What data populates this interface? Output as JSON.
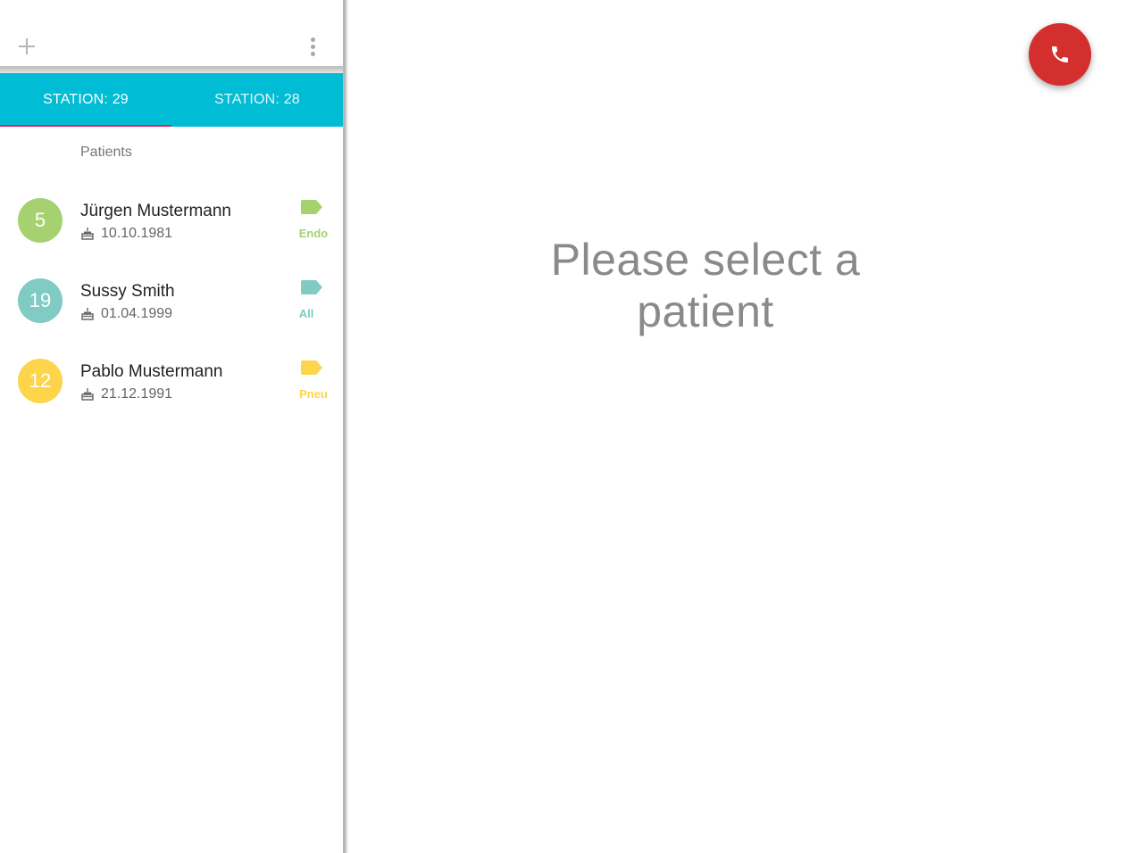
{
  "toolbar": {
    "add_icon": "plus-icon",
    "menu_icon": "more-vert-icon"
  },
  "tabs": [
    {
      "label": "STATION: 29",
      "selected": true
    },
    {
      "label": "STATION: 28",
      "selected": false
    }
  ],
  "colors": {
    "tab_bar": "#00bcd4",
    "tab_indicator": "#e91e63",
    "call_button": "#d32f2f"
  },
  "patients_header": "Patients",
  "patients": [
    {
      "number": "5",
      "name": "Jürgen Mustermann",
      "dob": "10.10.1981",
      "tag": "Endo",
      "color": "#a5d16f"
    },
    {
      "number": "19",
      "name": "Sussy Smith",
      "dob": "01.04.1999",
      "tag": "All",
      "color": "#80cbc4"
    },
    {
      "number": "12",
      "name": "Pablo Mustermann",
      "dob": "21.12.1991",
      "tag": "Pneu",
      "color": "#fdd54a"
    }
  ],
  "main": {
    "placeholder_line1": "Please select a",
    "placeholder_line2": "patient",
    "call_icon": "phone-icon"
  }
}
